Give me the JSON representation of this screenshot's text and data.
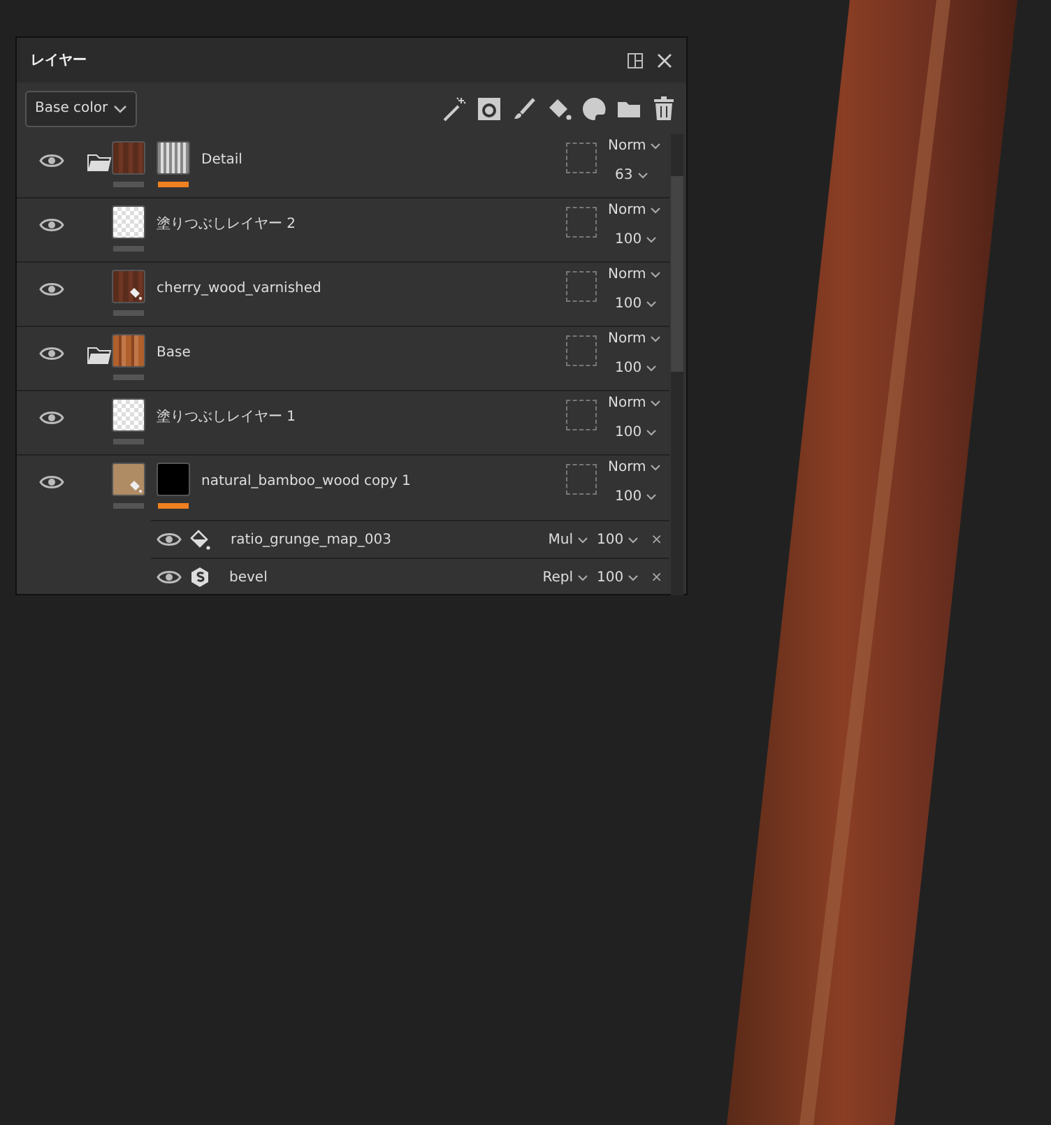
{
  "panel": {
    "title": "レイヤー",
    "channel_select": "Base color"
  },
  "layers": [
    {
      "name": "Detail",
      "visible": true,
      "folder": true,
      "thumbnail": {
        "kind": "wood-dark"
      },
      "mask": {
        "kind": "grunge",
        "selected": true
      },
      "blend": "Norm",
      "opacity": "63"
    },
    {
      "name": "塗りつぶしレイヤー 2",
      "visible": true,
      "folder": false,
      "thumbnail": {
        "kind": "checker"
      },
      "blend": "Norm",
      "opacity": "100"
    },
    {
      "name": "cherry_wood_varnished",
      "visible": true,
      "folder": false,
      "thumbnail": {
        "kind": "wood-dark"
      },
      "fill_badge": true,
      "blend": "Norm",
      "opacity": "100"
    },
    {
      "name": "Base",
      "visible": true,
      "folder": true,
      "thumbnail": {
        "kind": "wood-light"
      },
      "blend": "Norm",
      "opacity": "100"
    },
    {
      "name": "塗りつぶしレイヤー 1",
      "visible": true,
      "folder": false,
      "thumbnail": {
        "kind": "checker"
      },
      "blend": "Norm",
      "opacity": "100"
    },
    {
      "name": "natural_bamboo_wood copy 1",
      "visible": true,
      "folder": false,
      "thumbnail": {
        "kind": "tan"
      },
      "fill_badge": true,
      "mask": {
        "kind": "black",
        "selected": true
      },
      "blend": "Norm",
      "opacity": "100",
      "effects": [
        {
          "kind": "fill",
          "name": "ratio_grunge_map_003",
          "visible": true,
          "blend": "Mul",
          "opacity": "100",
          "close": "×"
        },
        {
          "kind": "filter",
          "name": "bevel",
          "visible": true,
          "blend": "Repl",
          "opacity": "100",
          "close": "×"
        }
      ]
    }
  ]
}
